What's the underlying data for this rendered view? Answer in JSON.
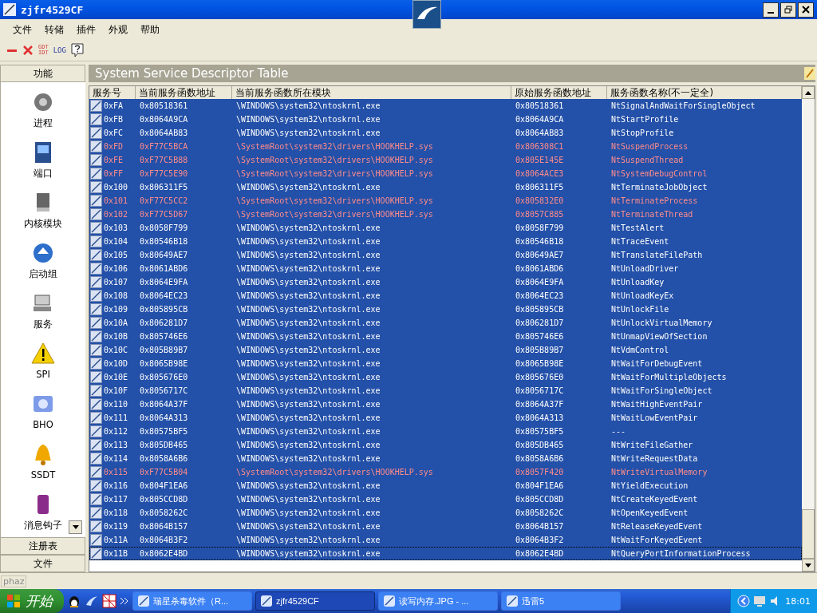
{
  "window": {
    "title": "zjfr4529CF"
  },
  "menu": [
    {
      "label": "文件"
    },
    {
      "label": "转储"
    },
    {
      "label": "插件"
    },
    {
      "label": "外观"
    },
    {
      "label": "帮助"
    }
  ],
  "toolbar": {
    "gdt_label": "GDT",
    "idt_label": "IDT",
    "log_label": "LOG"
  },
  "sidebar": {
    "title": "功能",
    "items": [
      {
        "label": "进程"
      },
      {
        "label": "端口"
      },
      {
        "label": "内核模块"
      },
      {
        "label": "启动组"
      },
      {
        "label": "服务"
      },
      {
        "label": "SPI"
      },
      {
        "label": "BHO"
      },
      {
        "label": "SSDT"
      },
      {
        "label": "消息钩子"
      }
    ],
    "tabs": [
      {
        "label": "注册表"
      },
      {
        "label": "文件"
      }
    ]
  },
  "panel": {
    "title": "System Service Descriptor Table"
  },
  "table": {
    "columns": [
      "服务号",
      "当前服务函数地址",
      "当前服务函数所在模块",
      "原始服务函数地址",
      "服务函数名称(不一定全)"
    ],
    "rows": [
      {
        "index": "0xFA",
        "current": "0x80518361",
        "module": "\\WINDOWS\\system32\\ntoskrnl.exe",
        "original": "0x80518361",
        "name": "NtSignalAndWaitForSingleObject",
        "hooked": false,
        "selected": true,
        "focused": false
      },
      {
        "index": "0xFB",
        "current": "0x8064A9CA",
        "module": "\\WINDOWS\\system32\\ntoskrnl.exe",
        "original": "0x8064A9CA",
        "name": "NtStartProfile",
        "hooked": false,
        "selected": true,
        "focused": false
      },
      {
        "index": "0xFC",
        "current": "0x8064AB83",
        "module": "\\WINDOWS\\system32\\ntoskrnl.exe",
        "original": "0x8064AB83",
        "name": "NtStopProfile",
        "hooked": false,
        "selected": true,
        "focused": false
      },
      {
        "index": "0xFD",
        "current": "0xF77C5BCA",
        "module": "\\SystemRoot\\system32\\drivers\\HOOKHELP.sys",
        "original": "0x806308C1",
        "name": "NtSuspendProcess",
        "hooked": true,
        "selected": true,
        "focused": false
      },
      {
        "index": "0xFE",
        "current": "0xF77C5B88",
        "module": "\\SystemRoot\\system32\\drivers\\HOOKHELP.sys",
        "original": "0x805E145E",
        "name": "NtSuspendThread",
        "hooked": true,
        "selected": true,
        "focused": false
      },
      {
        "index": "0xFF",
        "current": "0xF77C5E90",
        "module": "\\SystemRoot\\system32\\drivers\\HOOKHELP.sys",
        "original": "0x8064ACE3",
        "name": "NtSystemDebugControl",
        "hooked": true,
        "selected": true,
        "focused": false
      },
      {
        "index": "0x100",
        "current": "0x806311F5",
        "module": "\\WINDOWS\\system32\\ntoskrnl.exe",
        "original": "0x806311F5",
        "name": "NtTerminateJobObject",
        "hooked": false,
        "selected": true,
        "focused": false
      },
      {
        "index": "0x101",
        "current": "0xF77C5CC2",
        "module": "\\SystemRoot\\system32\\drivers\\HOOKHELP.sys",
        "original": "0x805832E0",
        "name": "NtTerminateProcess",
        "hooked": true,
        "selected": true,
        "focused": false
      },
      {
        "index": "0x102",
        "current": "0xF77C5D67",
        "module": "\\SystemRoot\\system32\\drivers\\HOOKHELP.sys",
        "original": "0x8057C885",
        "name": "NtTerminateThread",
        "hooked": true,
        "selected": true,
        "focused": false
      },
      {
        "index": "0x103",
        "current": "0x8058F799",
        "module": "\\WINDOWS\\system32\\ntoskrnl.exe",
        "original": "0x8058F799",
        "name": "NtTestAlert",
        "hooked": false,
        "selected": true,
        "focused": false
      },
      {
        "index": "0x104",
        "current": "0x80546B18",
        "module": "\\WINDOWS\\system32\\ntoskrnl.exe",
        "original": "0x80546B18",
        "name": "NtTraceEvent",
        "hooked": false,
        "selected": true,
        "focused": false
      },
      {
        "index": "0x105",
        "current": "0x80649AE7",
        "module": "\\WINDOWS\\system32\\ntoskrnl.exe",
        "original": "0x80649AE7",
        "name": "NtTranslateFilePath",
        "hooked": false,
        "selected": true,
        "focused": false
      },
      {
        "index": "0x106",
        "current": "0x8061ABD6",
        "module": "\\WINDOWS\\system32\\ntoskrnl.exe",
        "original": "0x8061ABD6",
        "name": "NtUnloadDriver",
        "hooked": false,
        "selected": true,
        "focused": false
      },
      {
        "index": "0x107",
        "current": "0x8064E9FA",
        "module": "\\WINDOWS\\system32\\ntoskrnl.exe",
        "original": "0x8064E9FA",
        "name": "NtUnloadKey",
        "hooked": false,
        "selected": true,
        "focused": false
      },
      {
        "index": "0x108",
        "current": "0x8064EC23",
        "module": "\\WINDOWS\\system32\\ntoskrnl.exe",
        "original": "0x8064EC23",
        "name": "NtUnloadKeyEx",
        "hooked": false,
        "selected": true,
        "focused": false
      },
      {
        "index": "0x109",
        "current": "0x805895CB",
        "module": "\\WINDOWS\\system32\\ntoskrnl.exe",
        "original": "0x805895CB",
        "name": "NtUnlockFile",
        "hooked": false,
        "selected": true,
        "focused": false
      },
      {
        "index": "0x10A",
        "current": "0x806281D7",
        "module": "\\WINDOWS\\system32\\ntoskrnl.exe",
        "original": "0x806281D7",
        "name": "NtUnlockVirtualMemory",
        "hooked": false,
        "selected": true,
        "focused": false
      },
      {
        "index": "0x10B",
        "current": "0x805746E6",
        "module": "\\WINDOWS\\system32\\ntoskrnl.exe",
        "original": "0x805746E6",
        "name": "NtUnmapViewOfSection",
        "hooked": false,
        "selected": true,
        "focused": false
      },
      {
        "index": "0x10C",
        "current": "0x805B89B7",
        "module": "\\WINDOWS\\system32\\ntoskrnl.exe",
        "original": "0x805B89B7",
        "name": "NtVdmControl",
        "hooked": false,
        "selected": true,
        "focused": false
      },
      {
        "index": "0x10D",
        "current": "0x8065B98E",
        "module": "\\WINDOWS\\system32\\ntoskrnl.exe",
        "original": "0x8065B98E",
        "name": "NtWaitForDebugEvent",
        "hooked": false,
        "selected": true,
        "focused": false
      },
      {
        "index": "0x10E",
        "current": "0x805676E0",
        "module": "\\WINDOWS\\system32\\ntoskrnl.exe",
        "original": "0x805676E0",
        "name": "NtWaitForMultipleObjects",
        "hooked": false,
        "selected": true,
        "focused": false
      },
      {
        "index": "0x10F",
        "current": "0x8056717C",
        "module": "\\WINDOWS\\system32\\ntoskrnl.exe",
        "original": "0x8056717C",
        "name": "NtWaitForSingleObject",
        "hooked": false,
        "selected": true,
        "focused": false
      },
      {
        "index": "0x110",
        "current": "0x8064A37F",
        "module": "\\WINDOWS\\system32\\ntoskrnl.exe",
        "original": "0x8064A37F",
        "name": "NtWaitHighEventPair",
        "hooked": false,
        "selected": true,
        "focused": false
      },
      {
        "index": "0x111",
        "current": "0x8064A313",
        "module": "\\WINDOWS\\system32\\ntoskrnl.exe",
        "original": "0x8064A313",
        "name": "NtWaitLowEventPair",
        "hooked": false,
        "selected": true,
        "focused": false
      },
      {
        "index": "0x112",
        "current": "0x80575BF5",
        "module": "\\WINDOWS\\system32\\ntoskrnl.exe",
        "original": "0x80575BF5",
        "name": "---",
        "hooked": false,
        "selected": true,
        "focused": false
      },
      {
        "index": "0x113",
        "current": "0x805DB465",
        "module": "\\WINDOWS\\system32\\ntoskrnl.exe",
        "original": "0x805DB465",
        "name": "NtWriteFileGather",
        "hooked": false,
        "selected": true,
        "focused": false
      },
      {
        "index": "0x114",
        "current": "0x8058A6B6",
        "module": "\\WINDOWS\\system32\\ntoskrnl.exe",
        "original": "0x8058A6B6",
        "name": "NtWriteRequestData",
        "hooked": false,
        "selected": true,
        "focused": false
      },
      {
        "index": "0x115",
        "current": "0xF77C5B04",
        "module": "\\SystemRoot\\system32\\drivers\\HOOKHELP.sys",
        "original": "0x8057F420",
        "name": "NtWriteVirtualMemory",
        "hooked": true,
        "selected": true,
        "focused": false
      },
      {
        "index": "0x116",
        "current": "0x804F1EA6",
        "module": "\\WINDOWS\\system32\\ntoskrnl.exe",
        "original": "0x804F1EA6",
        "name": "NtYieldExecution",
        "hooked": false,
        "selected": true,
        "focused": false
      },
      {
        "index": "0x117",
        "current": "0x805CCD8D",
        "module": "\\WINDOWS\\system32\\ntoskrnl.exe",
        "original": "0x805CCD8D",
        "name": "NtCreateKeyedEvent",
        "hooked": false,
        "selected": true,
        "focused": false
      },
      {
        "index": "0x118",
        "current": "0x8058262C",
        "module": "\\WINDOWS\\system32\\ntoskrnl.exe",
        "original": "0x8058262C",
        "name": "NtOpenKeyedEvent",
        "hooked": false,
        "selected": true,
        "focused": false
      },
      {
        "index": "0x119",
        "current": "0x8064B157",
        "module": "\\WINDOWS\\system32\\ntoskrnl.exe",
        "original": "0x8064B157",
        "name": "NtReleaseKeyedEvent",
        "hooked": false,
        "selected": true,
        "focused": false
      },
      {
        "index": "0x11A",
        "current": "0x8064B3F2",
        "module": "\\WINDOWS\\system32\\ntoskrnl.exe",
        "original": "0x8064B3F2",
        "name": "NtWaitForKeyedEvent",
        "hooked": false,
        "selected": true,
        "focused": false
      },
      {
        "index": "0x11B",
        "current": "0x8062E4BD",
        "module": "\\WINDOWS\\system32\\ntoskrnl.exe",
        "original": "0x8062E4BD",
        "name": "NtQueryPortInformationProcess",
        "hooked": false,
        "selected": true,
        "focused": true
      }
    ]
  },
  "status_bar": {
    "text": "phaz"
  },
  "taskbar": {
    "start": "开始",
    "tasks": [
      {
        "label": "瑞星杀毒软件（R...",
        "selected": false
      },
      {
        "label": "zjfr4529CF",
        "selected": true
      },
      {
        "label": "读写内存.JPG - ...",
        "selected": false
      },
      {
        "label": "迅雷5",
        "selected": false
      }
    ],
    "clock": "18:01"
  }
}
